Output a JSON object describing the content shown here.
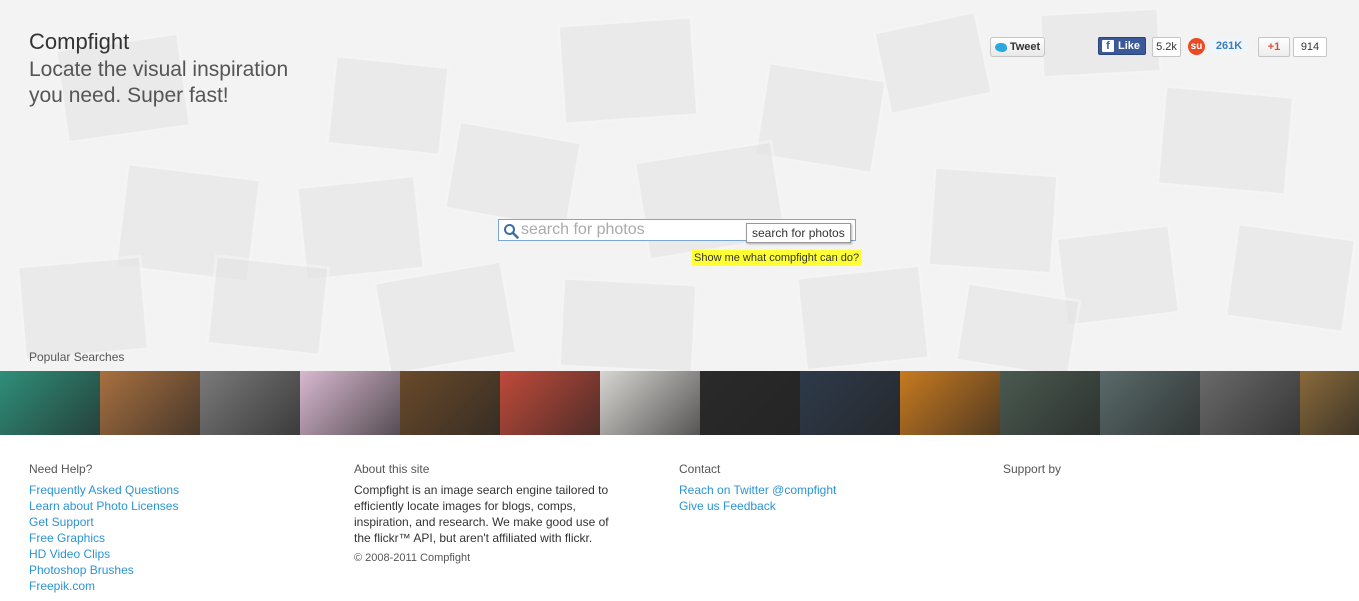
{
  "brand": {
    "name": "Compfight",
    "tagline": "Locate the visual inspiration you need. Super fast!"
  },
  "social": {
    "tweet_label": "Tweet",
    "fb_like_label": "Like",
    "fb_count": "5.2k",
    "stumble_count": "261K",
    "gplus_label": "+1",
    "gplus_count": "914"
  },
  "search": {
    "placeholder": "search for photos",
    "tooltip": "search for photos",
    "show_me": "Show me what compfight can do?"
  },
  "popular": {
    "label": "Popular Searches",
    "thumbnails": [
      {
        "color": "#2f8f7a"
      },
      {
        "color": "#a87040"
      },
      {
        "color": "#7a7a7a"
      },
      {
        "color": "#d8b8d0"
      },
      {
        "color": "#6a4a2a"
      },
      {
        "color": "#c04a3a"
      },
      {
        "color": "#d8d6d2"
      },
      {
        "color": "#2a2a2a"
      },
      {
        "color": "#2e3a4a"
      },
      {
        "color": "#c87a20"
      },
      {
        "color": "#4a5a50"
      },
      {
        "color": "#5a6a6a"
      },
      {
        "color": "#6a6a6a"
      },
      {
        "color": "#8a6a3a"
      }
    ]
  },
  "footer": {
    "help": {
      "title": "Need Help?",
      "links": [
        "Frequently Asked Questions",
        "Learn about Photo Licenses",
        "Get Support",
        "Free Graphics",
        "HD Video Clips",
        "Photoshop Brushes",
        "Freepik.com"
      ]
    },
    "about": {
      "title": "About this site",
      "text": "Compfight is an image search engine tailored to efficiently locate images for blogs, comps, inspiration, and research. We make good use of the flickr™ API, but aren't affiliated with flickr.",
      "copyright": "© 2008-2011 Compfight"
    },
    "contact": {
      "title": "Contact",
      "links": [
        "Reach on Twitter @compfight",
        "Give us Feedback"
      ]
    },
    "support": {
      "title": "Support by"
    }
  }
}
